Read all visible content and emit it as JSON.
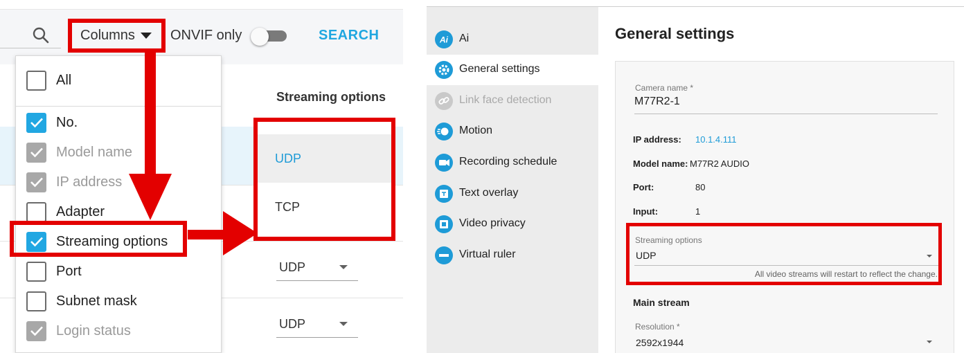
{
  "left_panel": {
    "toolbar": {
      "search_icon": "search-icon",
      "columns_label": "Columns",
      "onvif_label": "ONVIF only",
      "onvif_enabled": false,
      "search_label": "SEARCH"
    },
    "table": {
      "streaming_header": "Streaming options",
      "rows": [
        {
          "streaming": "UDP"
        },
        {
          "streaming": "UDP"
        }
      ]
    },
    "columns_menu": {
      "items": [
        {
          "label": "All",
          "state": "unchecked"
        },
        {
          "label": "No.",
          "state": "checked"
        },
        {
          "label": "Model name",
          "state": "disabled-checked"
        },
        {
          "label": "IP address",
          "state": "disabled-checked"
        },
        {
          "label": "Adapter",
          "state": "unchecked"
        },
        {
          "label": "Streaming options",
          "state": "checked"
        },
        {
          "label": "Port",
          "state": "unchecked"
        },
        {
          "label": "Subnet mask",
          "state": "unchecked"
        },
        {
          "label": "Login status",
          "state": "disabled-checked"
        }
      ]
    },
    "streaming_menu": {
      "options": [
        "UDP",
        "TCP"
      ],
      "selected": "UDP"
    },
    "colors": {
      "accent": "#1e9bd7",
      "annotation": "#e30000",
      "row_highlight": "#e7f4fb"
    }
  },
  "right_panel": {
    "sidebar": {
      "items": [
        {
          "label": "Ai",
          "icon": "ai-icon",
          "state": "normal"
        },
        {
          "label": "General settings",
          "icon": "gear-icon",
          "state": "active"
        },
        {
          "label": "Link face detection",
          "icon": "link-icon",
          "state": "disabled"
        },
        {
          "label": "Motion",
          "icon": "motion-icon",
          "state": "normal"
        },
        {
          "label": "Recording schedule",
          "icon": "video-camera-icon",
          "state": "normal"
        },
        {
          "label": "Text overlay",
          "icon": "text-overlay-icon",
          "state": "normal"
        },
        {
          "label": "Video privacy",
          "icon": "privacy-mask-icon",
          "state": "normal"
        },
        {
          "label": "Virtual ruler",
          "icon": "ruler-icon",
          "state": "normal"
        }
      ]
    },
    "general": {
      "title": "General settings",
      "camera_name_label": "Camera name *",
      "camera_name_value": "M77R2-1",
      "ip_key": "IP address:",
      "ip_value": "10.1.4.111",
      "model_key": "Model name:",
      "model_value": "M77R2 AUDIO",
      "port_key": "Port:",
      "port_value": "80",
      "input_key": "Input:",
      "input_value": "1",
      "streaming_label": "Streaming options",
      "streaming_value": "UDP",
      "streaming_hint": "All video streams will restart to reflect the change.",
      "main_stream_title": "Main stream",
      "resolution_label": "Resolution *",
      "resolution_value": "2592x1944"
    }
  }
}
